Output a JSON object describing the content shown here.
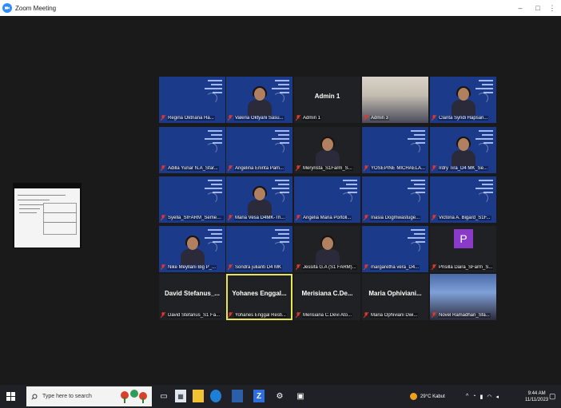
{
  "window": {
    "title": "Zoom Meeting",
    "minimize": "–",
    "maximize": "□",
    "more": "⋮"
  },
  "gallery": {
    "tiles": [
      {
        "label": "Regina Oktriana Ha...",
        "type": "blue"
      },
      {
        "label": "Valeria Oktyani Sasu...",
        "type": "blue-person"
      },
      {
        "label": "Admin 1",
        "type": "name",
        "big": "Admin 1"
      },
      {
        "label": "Admin 3",
        "type": "room"
      },
      {
        "label": "Clarita Syndi Hapsari...",
        "type": "blue-person"
      },
      {
        "label": "Adilla Yunar N.A_Sfar...",
        "type": "blue"
      },
      {
        "label": "Angelina Eninta Pam...",
        "type": "blue"
      },
      {
        "label": "Meryrista_S1Farm_S...",
        "type": "dark-person"
      },
      {
        "label": "YOSEPINE MICHAELA...",
        "type": "blue"
      },
      {
        "label": "Irdry Tira_D4 MK_Se...",
        "type": "blue-person"
      },
      {
        "label": "Syella_SIFARM_Semest...",
        "type": "blue"
      },
      {
        "label": "Maria Vesa D4MK-Th...",
        "type": "blue-person2"
      },
      {
        "label": "Angelia Maria Portoli...",
        "type": "blue"
      },
      {
        "label": "Inasia Dogmwastuge...",
        "type": "blue"
      },
      {
        "label": "Victoria A. Bigard_S1F...",
        "type": "blue"
      },
      {
        "label": "Nike Meyllani Big P_...",
        "type": "blue-person"
      },
      {
        "label": "Sondra julianti D4 MK",
        "type": "blue"
      },
      {
        "label": "Jessifa G.A (S1 FARM)...",
        "type": "dark-person"
      },
      {
        "label": "margaretha vera_D4...",
        "type": "blue"
      },
      {
        "label": "Prisilla Daira_SFarm_S...",
        "type": "avatar",
        "initial": "P"
      },
      {
        "label": "David Stefanus_S1 Fa...",
        "type": "name",
        "big": "David Stefanus_..."
      },
      {
        "label": "Yohanes Enggal Resti...",
        "type": "name",
        "big": "Yohanes Enggal...",
        "active": true
      },
      {
        "label": "Merisiana C.Devi Ato...",
        "type": "name",
        "big": "Merisiana C.De..."
      },
      {
        "label": "Maria Ophiviani Dwi...",
        "type": "name",
        "big": "Maria Ophiviani..."
      },
      {
        "label": "Novel Ramadhan_Sfa...",
        "type": "scene"
      }
    ]
  },
  "taskbar": {
    "search_placeholder": "Type here to search",
    "weather": "29°C Kabut",
    "time": "9:44 AM",
    "date": "11/11/2023"
  },
  "colors": {
    "meeting_bg": "#1a1a1a",
    "tile_blue": "#1b3a8a",
    "active_speaker": "#e6e65a",
    "muted_mic": "#e0382c",
    "avatar_purple": "#8a3ac8"
  }
}
